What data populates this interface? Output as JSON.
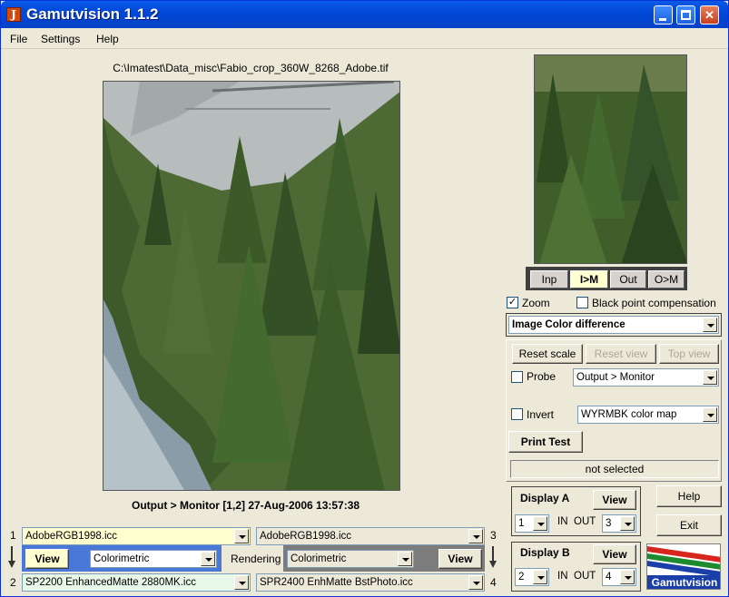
{
  "window": {
    "title": "Gamutvision 1.1.2",
    "app_icon_glyph": "J"
  },
  "menu": [
    "File",
    "Settings",
    "Help"
  ],
  "image": {
    "path": "C:\\Imatest\\Data_misc\\Fabio_crop_360W_8268_Adobe.tif",
    "caption": "Output > Monitor  [1,2]    27-Aug-2006 13:57:38"
  },
  "view_tabs": [
    {
      "label": "Inp",
      "active": false
    },
    {
      "label": "I>M",
      "active": true
    },
    {
      "label": "Out",
      "active": false
    },
    {
      "label": "O>M",
      "active": false
    }
  ],
  "zoom": {
    "label": "Zoom",
    "checked": true
  },
  "black_point": {
    "label": "Black point compensation",
    "checked": false
  },
  "display_mode": "Image Color difference",
  "buttons": {
    "reset_scale": "Reset scale",
    "reset_view": "Reset view",
    "top_view": "Top view",
    "print_test": "Print Test",
    "help": "Help",
    "exit": "Exit",
    "view": "View"
  },
  "probe": {
    "label": "Probe",
    "checked": false,
    "value": "Output > Monitor"
  },
  "invert": {
    "label": "Invert",
    "checked": false,
    "value": "WYRMBK color map"
  },
  "status": "not selected",
  "display_a": {
    "title": "Display A",
    "in": "1",
    "out": "3",
    "in_label": "IN",
    "out_label": "OUT"
  },
  "display_b": {
    "title": "Display B",
    "in": "2",
    "out": "4",
    "in_label": "IN",
    "out_label": "OUT"
  },
  "profiles": {
    "p1": {
      "num": "1",
      "value": "AdobeRGB1998.icc"
    },
    "p2": {
      "num": "2",
      "value": "SP2200 EnhancedMatte 2880MK.icc"
    },
    "p3": {
      "num": "3",
      "value": "AdobeRGB1998.icc"
    },
    "p4": {
      "num": "4",
      "value": "SPR2400 EnhMatte BstPhoto.icc"
    }
  },
  "rendering": {
    "label": "Rendering",
    "left": "Colorimetric",
    "right": "Colorimetric"
  },
  "logo_text": "Gamutvision",
  "colors": {
    "titlebar": "#0148d8",
    "highlight": "#ffffd0",
    "blue_frame": "#4a78d8",
    "gray_frame": "#7c7c7c"
  }
}
